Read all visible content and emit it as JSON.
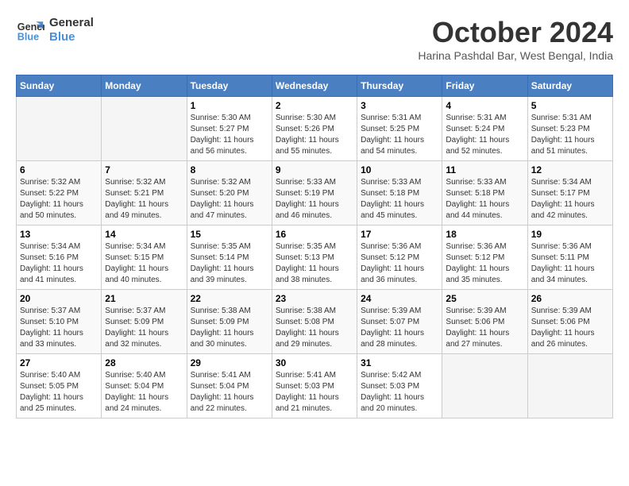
{
  "header": {
    "logo_line1": "General",
    "logo_line2": "Blue",
    "month": "October 2024",
    "location": "Harina Pashdal Bar, West Bengal, India"
  },
  "days_of_week": [
    "Sunday",
    "Monday",
    "Tuesday",
    "Wednesday",
    "Thursday",
    "Friday",
    "Saturday"
  ],
  "weeks": [
    [
      {
        "num": "",
        "info": ""
      },
      {
        "num": "",
        "info": ""
      },
      {
        "num": "1",
        "info": "Sunrise: 5:30 AM\nSunset: 5:27 PM\nDaylight: 11 hours and 56 minutes."
      },
      {
        "num": "2",
        "info": "Sunrise: 5:30 AM\nSunset: 5:26 PM\nDaylight: 11 hours and 55 minutes."
      },
      {
        "num": "3",
        "info": "Sunrise: 5:31 AM\nSunset: 5:25 PM\nDaylight: 11 hours and 54 minutes."
      },
      {
        "num": "4",
        "info": "Sunrise: 5:31 AM\nSunset: 5:24 PM\nDaylight: 11 hours and 52 minutes."
      },
      {
        "num": "5",
        "info": "Sunrise: 5:31 AM\nSunset: 5:23 PM\nDaylight: 11 hours and 51 minutes."
      }
    ],
    [
      {
        "num": "6",
        "info": "Sunrise: 5:32 AM\nSunset: 5:22 PM\nDaylight: 11 hours and 50 minutes."
      },
      {
        "num": "7",
        "info": "Sunrise: 5:32 AM\nSunset: 5:21 PM\nDaylight: 11 hours and 49 minutes."
      },
      {
        "num": "8",
        "info": "Sunrise: 5:32 AM\nSunset: 5:20 PM\nDaylight: 11 hours and 47 minutes."
      },
      {
        "num": "9",
        "info": "Sunrise: 5:33 AM\nSunset: 5:19 PM\nDaylight: 11 hours and 46 minutes."
      },
      {
        "num": "10",
        "info": "Sunrise: 5:33 AM\nSunset: 5:18 PM\nDaylight: 11 hours and 45 minutes."
      },
      {
        "num": "11",
        "info": "Sunrise: 5:33 AM\nSunset: 5:18 PM\nDaylight: 11 hours and 44 minutes."
      },
      {
        "num": "12",
        "info": "Sunrise: 5:34 AM\nSunset: 5:17 PM\nDaylight: 11 hours and 42 minutes."
      }
    ],
    [
      {
        "num": "13",
        "info": "Sunrise: 5:34 AM\nSunset: 5:16 PM\nDaylight: 11 hours and 41 minutes."
      },
      {
        "num": "14",
        "info": "Sunrise: 5:34 AM\nSunset: 5:15 PM\nDaylight: 11 hours and 40 minutes."
      },
      {
        "num": "15",
        "info": "Sunrise: 5:35 AM\nSunset: 5:14 PM\nDaylight: 11 hours and 39 minutes."
      },
      {
        "num": "16",
        "info": "Sunrise: 5:35 AM\nSunset: 5:13 PM\nDaylight: 11 hours and 38 minutes."
      },
      {
        "num": "17",
        "info": "Sunrise: 5:36 AM\nSunset: 5:12 PM\nDaylight: 11 hours and 36 minutes."
      },
      {
        "num": "18",
        "info": "Sunrise: 5:36 AM\nSunset: 5:12 PM\nDaylight: 11 hours and 35 minutes."
      },
      {
        "num": "19",
        "info": "Sunrise: 5:36 AM\nSunset: 5:11 PM\nDaylight: 11 hours and 34 minutes."
      }
    ],
    [
      {
        "num": "20",
        "info": "Sunrise: 5:37 AM\nSunset: 5:10 PM\nDaylight: 11 hours and 33 minutes."
      },
      {
        "num": "21",
        "info": "Sunrise: 5:37 AM\nSunset: 5:09 PM\nDaylight: 11 hours and 32 minutes."
      },
      {
        "num": "22",
        "info": "Sunrise: 5:38 AM\nSunset: 5:09 PM\nDaylight: 11 hours and 30 minutes."
      },
      {
        "num": "23",
        "info": "Sunrise: 5:38 AM\nSunset: 5:08 PM\nDaylight: 11 hours and 29 minutes."
      },
      {
        "num": "24",
        "info": "Sunrise: 5:39 AM\nSunset: 5:07 PM\nDaylight: 11 hours and 28 minutes."
      },
      {
        "num": "25",
        "info": "Sunrise: 5:39 AM\nSunset: 5:06 PM\nDaylight: 11 hours and 27 minutes."
      },
      {
        "num": "26",
        "info": "Sunrise: 5:39 AM\nSunset: 5:06 PM\nDaylight: 11 hours and 26 minutes."
      }
    ],
    [
      {
        "num": "27",
        "info": "Sunrise: 5:40 AM\nSunset: 5:05 PM\nDaylight: 11 hours and 25 minutes."
      },
      {
        "num": "28",
        "info": "Sunrise: 5:40 AM\nSunset: 5:04 PM\nDaylight: 11 hours and 24 minutes."
      },
      {
        "num": "29",
        "info": "Sunrise: 5:41 AM\nSunset: 5:04 PM\nDaylight: 11 hours and 22 minutes."
      },
      {
        "num": "30",
        "info": "Sunrise: 5:41 AM\nSunset: 5:03 PM\nDaylight: 11 hours and 21 minutes."
      },
      {
        "num": "31",
        "info": "Sunrise: 5:42 AM\nSunset: 5:03 PM\nDaylight: 11 hours and 20 minutes."
      },
      {
        "num": "",
        "info": ""
      },
      {
        "num": "",
        "info": ""
      }
    ]
  ]
}
